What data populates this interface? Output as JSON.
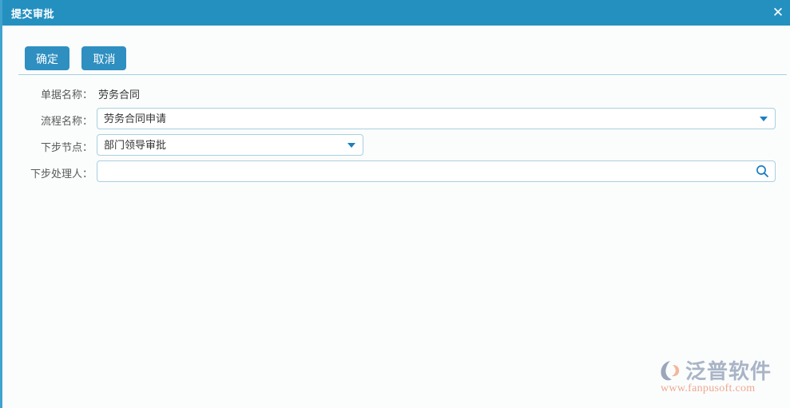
{
  "window": {
    "title": "提交审批",
    "close_label": "✕",
    "title_bar_color": "#2490c0",
    "accent_color": "#2e8fc0",
    "border_color": "#a8cfe0"
  },
  "toolbar": {
    "confirm_label": "确定",
    "cancel_label": "取消"
  },
  "form": {
    "rows": [
      {
        "label": "单据名称：",
        "type": "static",
        "value": "劳务合同"
      },
      {
        "label": "流程名称：",
        "type": "select",
        "value": "劳务合同申请",
        "icon": "chevron-down-icon"
      },
      {
        "label": "下步节点：",
        "type": "select",
        "value": "部门领导审批",
        "icon": "chevron-down-icon"
      },
      {
        "label": "下步处理人：",
        "type": "search",
        "value": "",
        "placeholder": "",
        "icon": "search-icon"
      }
    ]
  },
  "watermark": {
    "brand": "泛普软件",
    "url": "www.fanpusoft.com",
    "brand_color": "#a9b4c6",
    "url_color": "#f0a890"
  }
}
